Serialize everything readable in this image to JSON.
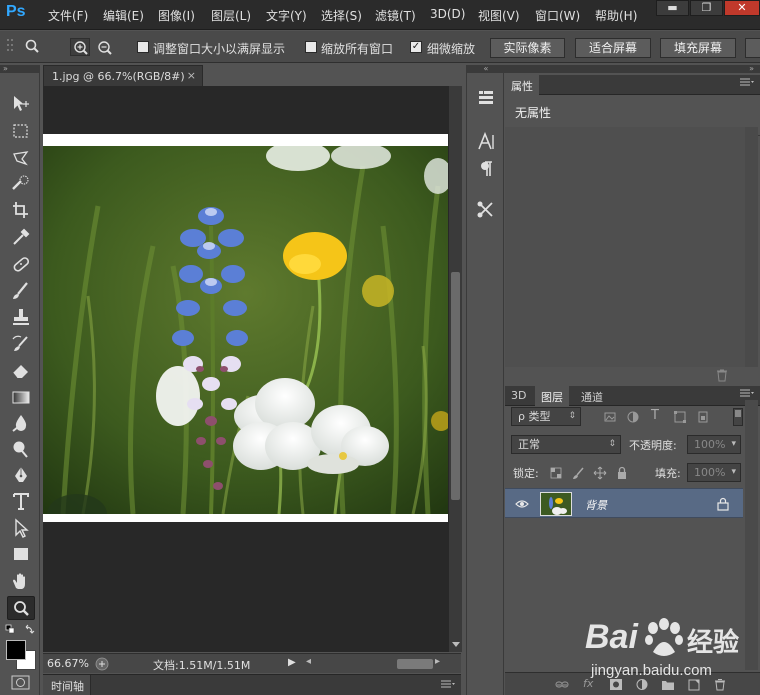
{
  "app": {
    "logo": "Ps"
  },
  "menu": [
    "文件(F)",
    "编辑(E)",
    "图像(I)",
    "图层(L)",
    "文字(Y)",
    "选择(S)",
    "滤镜(T)",
    "3D(D)",
    "视图(V)",
    "窗口(W)",
    "帮助(H)"
  ],
  "window_controls": {
    "minimize": "▬",
    "restore": "❐",
    "close": "✕"
  },
  "options": {
    "checkbox_1": {
      "label": "调整窗口大小以满屏显示",
      "checked": false
    },
    "checkbox_2": {
      "label": "缩放所有窗口",
      "checked": false
    },
    "checkbox_3": {
      "label": "细微缩放",
      "checked": true,
      "mark": "✓"
    },
    "buttons": [
      "实际像素",
      "适合屏幕",
      "填充屏幕"
    ]
  },
  "document": {
    "tab_label": "1.jpg @ 66.7%(RGB/8#)",
    "tab_close": "×",
    "zoom": "66.67%",
    "doc_info": "文档:1.51M/1.51M",
    "play_glyph": "▶",
    "arrow_left": "◂",
    "arrow_right": "▸"
  },
  "timeline": {
    "label": "时间轴"
  },
  "properties": {
    "tab": "属性",
    "empty_text": "无属性"
  },
  "layers": {
    "tabs": [
      "3D",
      "图层",
      "通道"
    ],
    "filter_kind": "ρ 类型",
    "blend_mode": "正常",
    "opacity_label": "不透明度:",
    "opacity_value": "100%",
    "lock_label": "锁定:",
    "fill_label": "填充:",
    "fill_value": "100%",
    "layer_name": "背景"
  },
  "watermark": {
    "brand": "Bai",
    "brand_cn": "经验",
    "url": "jingyan.baidu.com"
  },
  "colors": {
    "accent": "#31a8ff",
    "selected_layer": "#586a85"
  }
}
